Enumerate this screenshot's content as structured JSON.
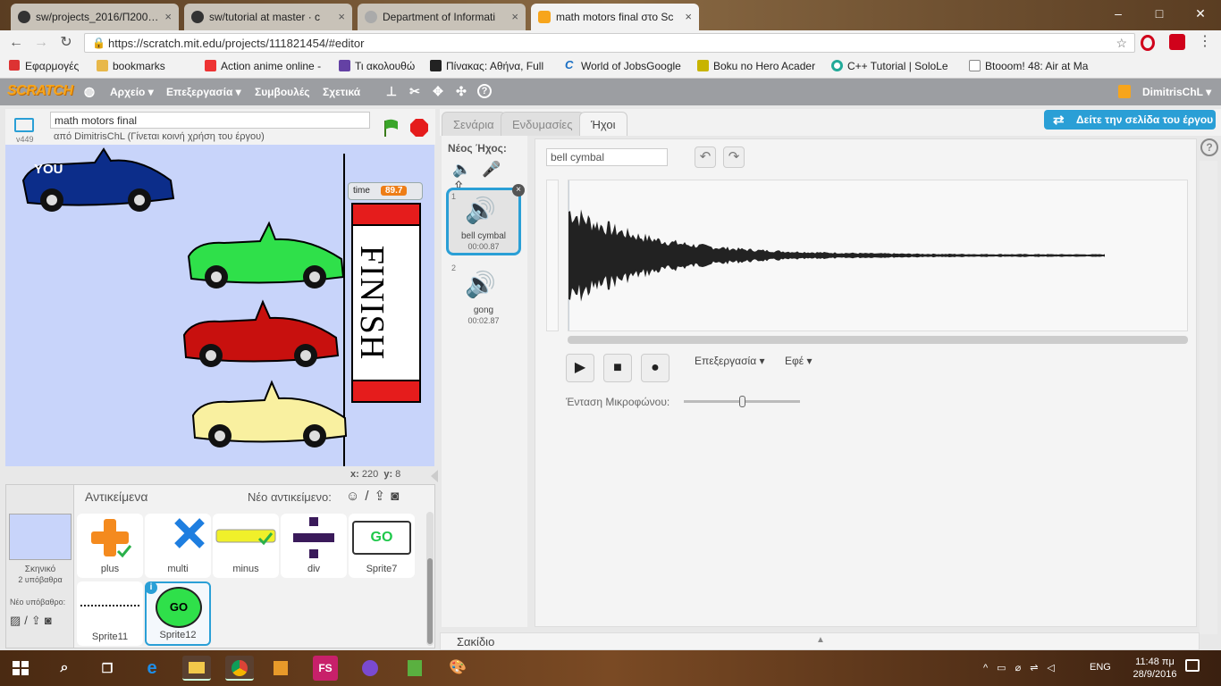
{
  "browser": {
    "tabs": [
      {
        "label": "sw/projects_2016/Π200…",
        "active": false
      },
      {
        "label": "sw/tutorial at master · c",
        "active": false
      },
      {
        "label": "Department of Informati",
        "active": false
      },
      {
        "label": "math motors final στο Sc",
        "active": true
      }
    ],
    "url": "https://scratch.mit.edu/projects/111821454/#editor",
    "bookmarks": [
      "Εφαρμογές",
      "bookmarks",
      "Action anime online -",
      "Τι ακολουθώ",
      "Πίνακας: Αθήνα, Full",
      "World of JobsGoogle",
      "Boku no Hero Acader",
      "C++ Tutorial | SoloLe",
      "Btooom! 48: Air at Ma"
    ]
  },
  "scratch": {
    "logo": "SCRATCH",
    "menu": [
      "Αρχείο ▾",
      "Επεξεργασία ▾",
      "Συμβουλές",
      "Σχετικά"
    ],
    "user": "DimitrisChL ▾",
    "project_title": "math motors final",
    "byline": "από DimitrisChL (Γίνεται κοινή χρήση του έργου)",
    "version": "v449",
    "stage": {
      "you_label": "YOU",
      "time_label": "time",
      "time_value": "89.7",
      "finish_text": "FINISH"
    },
    "coords": {
      "x_label": "x:",
      "x": "220",
      "y_label": "y:",
      "y": "8"
    },
    "sprites_header": "Αντικείμενα",
    "new_sprite_label": "Νέο αντικείμενο:",
    "backdrop": {
      "label": "Σκηνικό",
      "count": "2 υπόβαθρα",
      "new_label": "Νέο υπόβαθρο:"
    },
    "sprites": [
      "plus",
      "multi",
      "minus",
      "div",
      "Sprite7",
      "Sprite11",
      "Sprite12"
    ],
    "sprite7_text": "GO",
    "sprite12_text": "GO",
    "panel_tabs": [
      "Σενάρια",
      "Ενδυμασίες",
      "Ήχοι"
    ],
    "see_project_page": "Δείτε την σελίδα του έργου",
    "new_sound_label": "Νέος Ήχος:",
    "sounds": [
      {
        "index": "1",
        "name": "bell cymbal",
        "duration": "00:00.87"
      },
      {
        "index": "2",
        "name": "gong",
        "duration": "00:02.87"
      }
    ],
    "sound_name_value": "bell cymbal",
    "edit_menu": "Επεξεργασία ▾",
    "effects_menu": "Εφέ ▾",
    "mic_volume_label": "Ένταση Μικροφώνου:",
    "mic_volume_level": 0.5,
    "backpack": "Σακίδιο",
    "help": "?"
  },
  "taskbar": {
    "lang": "ENG",
    "time": "11:48 πμ",
    "date": "28/9/2016",
    "fs_label": "FS"
  },
  "colors": {
    "scratch_blue": "#2a9fd6",
    "menu_gray": "#9c9ea2",
    "accent_orange": "#f7a51c"
  }
}
